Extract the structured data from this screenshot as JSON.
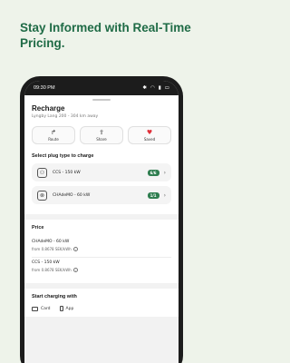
{
  "headline": "Stay Informed with Real-Time Pricing.",
  "statusbar": {
    "time": "09:30 PM"
  },
  "header": {
    "title": "Recharge",
    "subtitle": "Lyngby Lang 200 - 304 km away"
  },
  "actions": [
    {
      "label": "Route",
      "icon": "route-icon"
    },
    {
      "label": "Share",
      "icon": "share-icon"
    },
    {
      "label": "Saved",
      "icon": "heart-icon"
    }
  ],
  "plug_section": {
    "title": "Select plug type to charge",
    "plugs": [
      {
        "label": "CCS - 150 kW",
        "availability": "6/6"
      },
      {
        "label": "CHAdeMO - 60 kW",
        "availability": "1/1"
      }
    ]
  },
  "price": {
    "title": "Price",
    "rows": [
      {
        "name": "CHAdeMO - 60 kW",
        "value": "from 0.8678 SEK/kWh"
      },
      {
        "name": "CCS - 150 kW",
        "value": "from 0.8678 SEK/kWh"
      }
    ]
  },
  "start": {
    "title": "Start charging with",
    "methods": [
      {
        "label": "Card",
        "icon": "card-icon"
      },
      {
        "label": "App",
        "icon": "phone-icon"
      }
    ]
  },
  "colors": {
    "accent": "#1f6b46",
    "badge": "#2e7d4f",
    "saved": "#e0303a"
  }
}
